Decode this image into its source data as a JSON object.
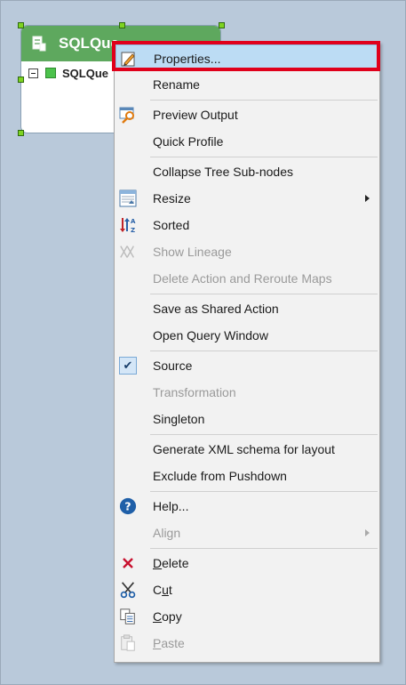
{
  "node": {
    "title": "SQLQue",
    "row_label": "SQLQue"
  },
  "menu": {
    "items": [
      {
        "id": "properties",
        "label": "Properties...",
        "icon": "pencil-icon",
        "enabled": true,
        "hover": true
      },
      {
        "id": "rename",
        "label": "Rename",
        "enabled": true
      },
      {
        "id": "preview-output",
        "label": "Preview Output",
        "icon": "preview-icon",
        "enabled": true
      },
      {
        "id": "quick-profile",
        "label": "Quick Profile",
        "enabled": true
      },
      {
        "id": "collapse-tree",
        "label": "Collapse Tree Sub-nodes",
        "enabled": true
      },
      {
        "id": "resize",
        "label": "Resize",
        "icon": "resize-icon",
        "enabled": true,
        "submenu": true
      },
      {
        "id": "sorted",
        "label": "Sorted",
        "icon": "sort-icon",
        "enabled": true
      },
      {
        "id": "show-lineage",
        "label": "Show Lineage",
        "icon": "lineage-icon",
        "enabled": false
      },
      {
        "id": "delete-action",
        "label": "Delete Action and Reroute Maps",
        "enabled": false
      },
      {
        "id": "save-shared",
        "label": "Save as Shared Action",
        "enabled": true
      },
      {
        "id": "open-query",
        "label": "Open Query Window",
        "enabled": true
      },
      {
        "id": "source",
        "label": "Source",
        "icon": "check-icon",
        "enabled": true,
        "checked": true
      },
      {
        "id": "transformation",
        "label": "Transformation",
        "enabled": false
      },
      {
        "id": "singleton",
        "label": "Singleton",
        "enabled": true
      },
      {
        "id": "gen-xml",
        "label": "Generate XML schema for layout",
        "enabled": true
      },
      {
        "id": "exclude-pushdown",
        "label": "Exclude from Pushdown",
        "enabled": true
      },
      {
        "id": "help",
        "label": "Help...",
        "icon": "help-icon",
        "enabled": true
      },
      {
        "id": "align",
        "label": "Align",
        "enabled": false,
        "submenu": true
      },
      {
        "id": "delete",
        "label": "Delete",
        "icon": "delete-icon",
        "enabled": true,
        "underline": "D"
      },
      {
        "id": "cut",
        "label": "Cut",
        "icon": "scissors-icon",
        "enabled": true,
        "underline": "u"
      },
      {
        "id": "copy",
        "label": "Copy",
        "icon": "copy-icon",
        "enabled": true,
        "underline": "C"
      },
      {
        "id": "paste",
        "label": "Paste",
        "icon": "paste-icon",
        "enabled": false,
        "underline": "P"
      }
    ]
  },
  "colors": {
    "canvas": "#b9c9da",
    "node_header": "#5ea85e",
    "hover": "#bcdcf4",
    "highlight": "#e0001b"
  }
}
